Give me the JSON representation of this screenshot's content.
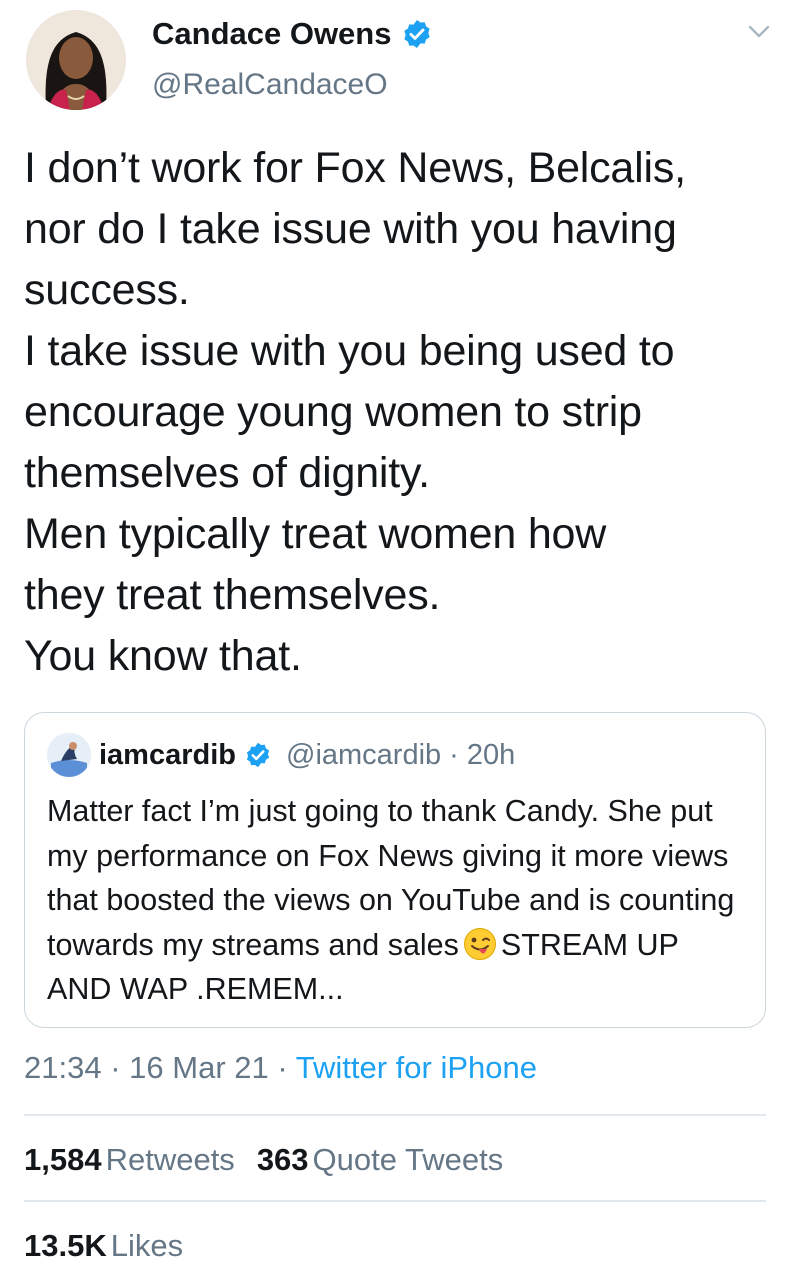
{
  "author": {
    "display_name": "Candace Owens",
    "handle": "@RealCandaceO",
    "verified": true
  },
  "tweet": {
    "text": "I don’t work for Fox News, Belcalis,\nnor do I take issue with you having\nsuccess.\nI take issue with you being used to\nencourage young women to strip\nthemselves of dignity.\nMen typically treat women how\nthey treat themselves.\nYou know that."
  },
  "quoted_tweet": {
    "display_name": "iamcardib",
    "handle": "@iamcardib",
    "separator": "·",
    "time": "20h",
    "text_before_emoji": "Matter fact I’m just going to thank Candy. She put my performance on Fox News giving it more views that boosted the views on YouTube and is counting towards my streams and sales",
    "emoji": "winking-face-with-tongue",
    "text_after_emoji": "STREAM UP AND WAP .REMEM..."
  },
  "meta": {
    "time": "21:34",
    "separator": "·",
    "date": "16 Mar 21",
    "separator2": "·",
    "source": "Twitter for iPhone"
  },
  "stats": {
    "retweets_count": "1,584",
    "retweets_label": "Retweets",
    "quotes_count": "363",
    "quotes_label": "Quote Tweets",
    "likes_count": "13.5K",
    "likes_label": "Likes"
  },
  "icons": {
    "verified": "verified-badge-icon",
    "menu": "chevron-down-icon"
  },
  "colors": {
    "accent": "#1da1f2",
    "text": "#14171a",
    "secondary": "#657786",
    "border": "#e1e8ed"
  }
}
